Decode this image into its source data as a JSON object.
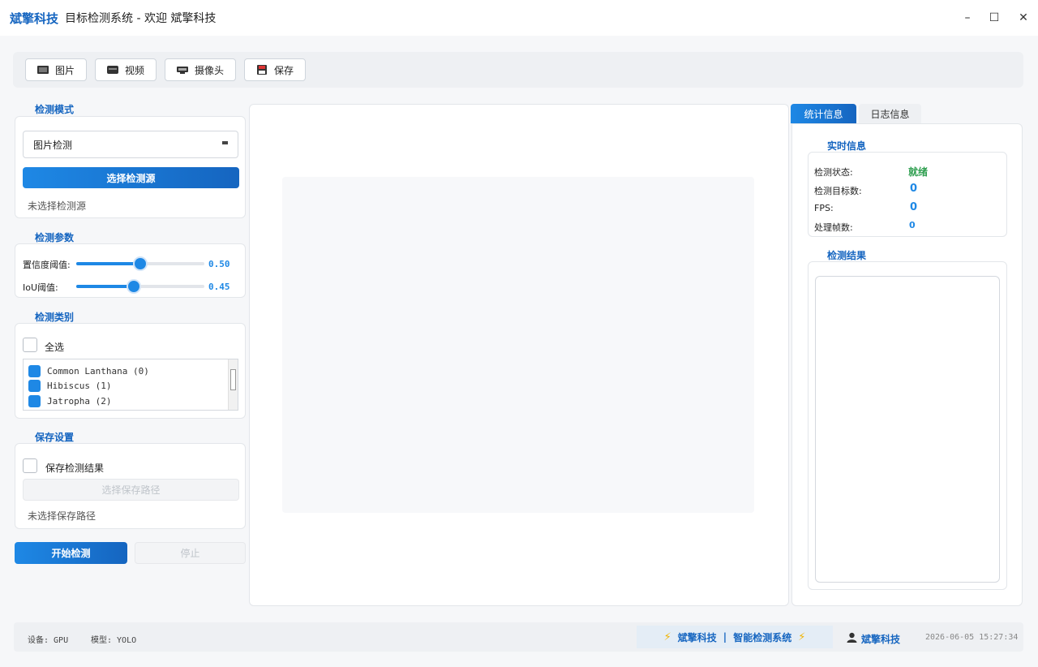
{
  "titlebar": {
    "brand": "斌擎科技",
    "title": "目标检测系统 - 欢迎 斌擎科技",
    "minimize": "–",
    "maximize": "☐",
    "close": "✕"
  },
  "toolbar": {
    "image_label": "图片",
    "video_label": "视频",
    "camera_label": "摄像头",
    "save_label": "保存"
  },
  "detect_mode": {
    "title": "检测模式",
    "selected": "图片检测",
    "select_source_label": "选择检测源",
    "source_status": "未选择检测源"
  },
  "params": {
    "title": "检测参数",
    "confidence_label": "置信度阈值:",
    "confidence_value": "0.50",
    "confidence_fraction": 0.5,
    "iou_label": "IoU阈值:",
    "iou_value": "0.45",
    "iou_fraction": 0.45
  },
  "classes": {
    "title": "检测类别",
    "select_all": "全选",
    "items": [
      "Common Lanthana (0)",
      "Hibiscus (1)",
      "Jatropha (2)"
    ]
  },
  "save_settings": {
    "title": "保存设置",
    "save_results": "保存检测结果",
    "choose_path": "选择保存路径",
    "path_status": "未选择保存路径"
  },
  "actions": {
    "start": "开始检测",
    "stop": "停止"
  },
  "right_panel": {
    "tab_stats": "统计信息",
    "tab_log": "日志信息",
    "realtime_title": "实时信息",
    "status_label": "检测状态:",
    "status_value": "就绪",
    "targets_label": "检测目标数:",
    "targets_value": "0",
    "fps_label": "FPS:",
    "fps_value": "0",
    "frames_label": "处理帧数:",
    "frames_value": "0",
    "results_title": "检测结果"
  },
  "statusbar": {
    "device": "设备: GPU",
    "model": "模型: YOLO",
    "brand_left": "斌擎科技",
    "separator": "|",
    "brand_right": "智能检测系统",
    "user": "斌擎科技",
    "datetime": "2026-06-05 15:27:34"
  },
  "colors": {
    "accent": "#1e88e5",
    "accent_dark": "#1565c0",
    "ready_green": "#2e9e4f"
  }
}
